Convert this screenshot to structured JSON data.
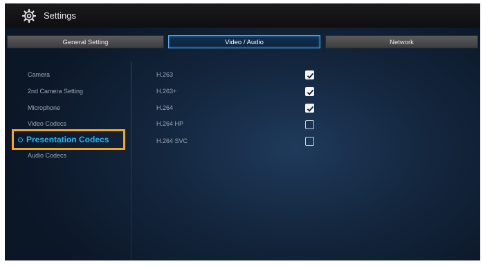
{
  "window": {
    "title": "Settings"
  },
  "tabs": [
    {
      "label": "General Setting",
      "active": false
    },
    {
      "label": "Video / Audio",
      "active": true
    },
    {
      "label": "Network",
      "active": false
    }
  ],
  "sidebar": {
    "items": [
      {
        "label": "Camera"
      },
      {
        "label": "2nd Camera Setting"
      },
      {
        "label": "Microphone"
      },
      {
        "label": "Video Codecs"
      },
      {
        "label": "Presentation Codecs",
        "selected": true
      },
      {
        "label": "Audio Codecs"
      }
    ]
  },
  "codecs": [
    {
      "label": "H.263",
      "checked": true
    },
    {
      "label": "H.263+",
      "checked": true
    },
    {
      "label": "H.264",
      "checked": true
    },
    {
      "label": "H.264 HP",
      "checked": false
    },
    {
      "label": "H.264 SVC",
      "checked": false
    }
  ],
  "colors": {
    "accent": "#28b7f0",
    "highlight": "#f3a623",
    "tab_active_border": "#4fb0e8"
  }
}
